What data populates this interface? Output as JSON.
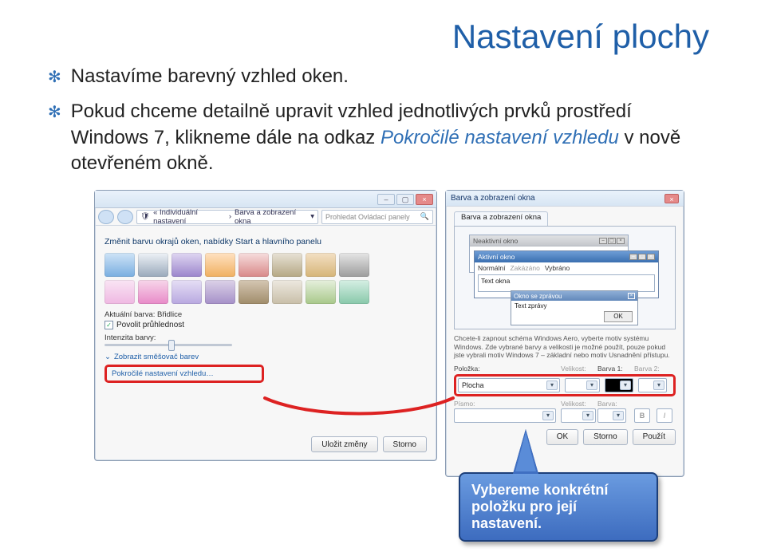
{
  "title": "Nastavení plochy",
  "bullets": {
    "b1": "Nastavíme barevný vzhled oken.",
    "b2_pre": "Pokud chceme detailně upravit vzhled jednotlivých prvků prostředí Windows 7, klikneme dále na odkaz ",
    "b2_em": "Pokročilé nastavení vzhledu",
    "b2_post": " v nově otevřeném okně."
  },
  "leftWin": {
    "breadcrumb_a": "« Individuální nastavení",
    "breadcrumb_b": "Barva a zobrazení okna",
    "search_placeholder": "Prohledat Ovládací panely",
    "heading": "Změnit barvu okrajů oken, nabídky Start a hlavního panelu",
    "current_color_label": "Aktuální barva: Břidlice",
    "transparency_label": "Povolit průhlednost",
    "intensity_label": "Intenzita barvy:",
    "mixer_link": "Zobrazit směšovač barev",
    "advanced_link": "Pokročilé nastavení vzhledu…",
    "save": "Uložit změny",
    "cancel": "Storno"
  },
  "rightWin": {
    "title": "Barva a zobrazení okna",
    "tab": "Barva a zobrazení okna",
    "inactive": "Neaktivní okno",
    "active": "Aktivní okno",
    "menu_normal": "Normální",
    "menu_disabled": "Zakázáno",
    "menu_selected": "Vybráno",
    "wintext": "Text okna",
    "msg_caption": "Okno se zprávou",
    "msg_text": "Text zprávy",
    "ok": "OK",
    "note": "Chcete-li zapnout schéma Windows Aero, vyberte motiv systému Windows. Zde vybrané barvy a velikosti je možné použít, pouze pokud jste vybrali motiv Windows 7 – základní nebo motiv Usnadnění přístupu.",
    "item_label": "Položka:",
    "size_label": "Velikost:",
    "color1_label": "Barva 1:",
    "color2_label": "Barva 2:",
    "item_value": "Plocha",
    "font_label": "Písmo:",
    "fsize_label": "Velikost:",
    "fcolor_label": "Barva:",
    "btn_ok": "OK",
    "btn_cancel": "Storno",
    "btn_apply": "Použít"
  },
  "callout": "Vybereme konkrétní položku pro její nastavení."
}
